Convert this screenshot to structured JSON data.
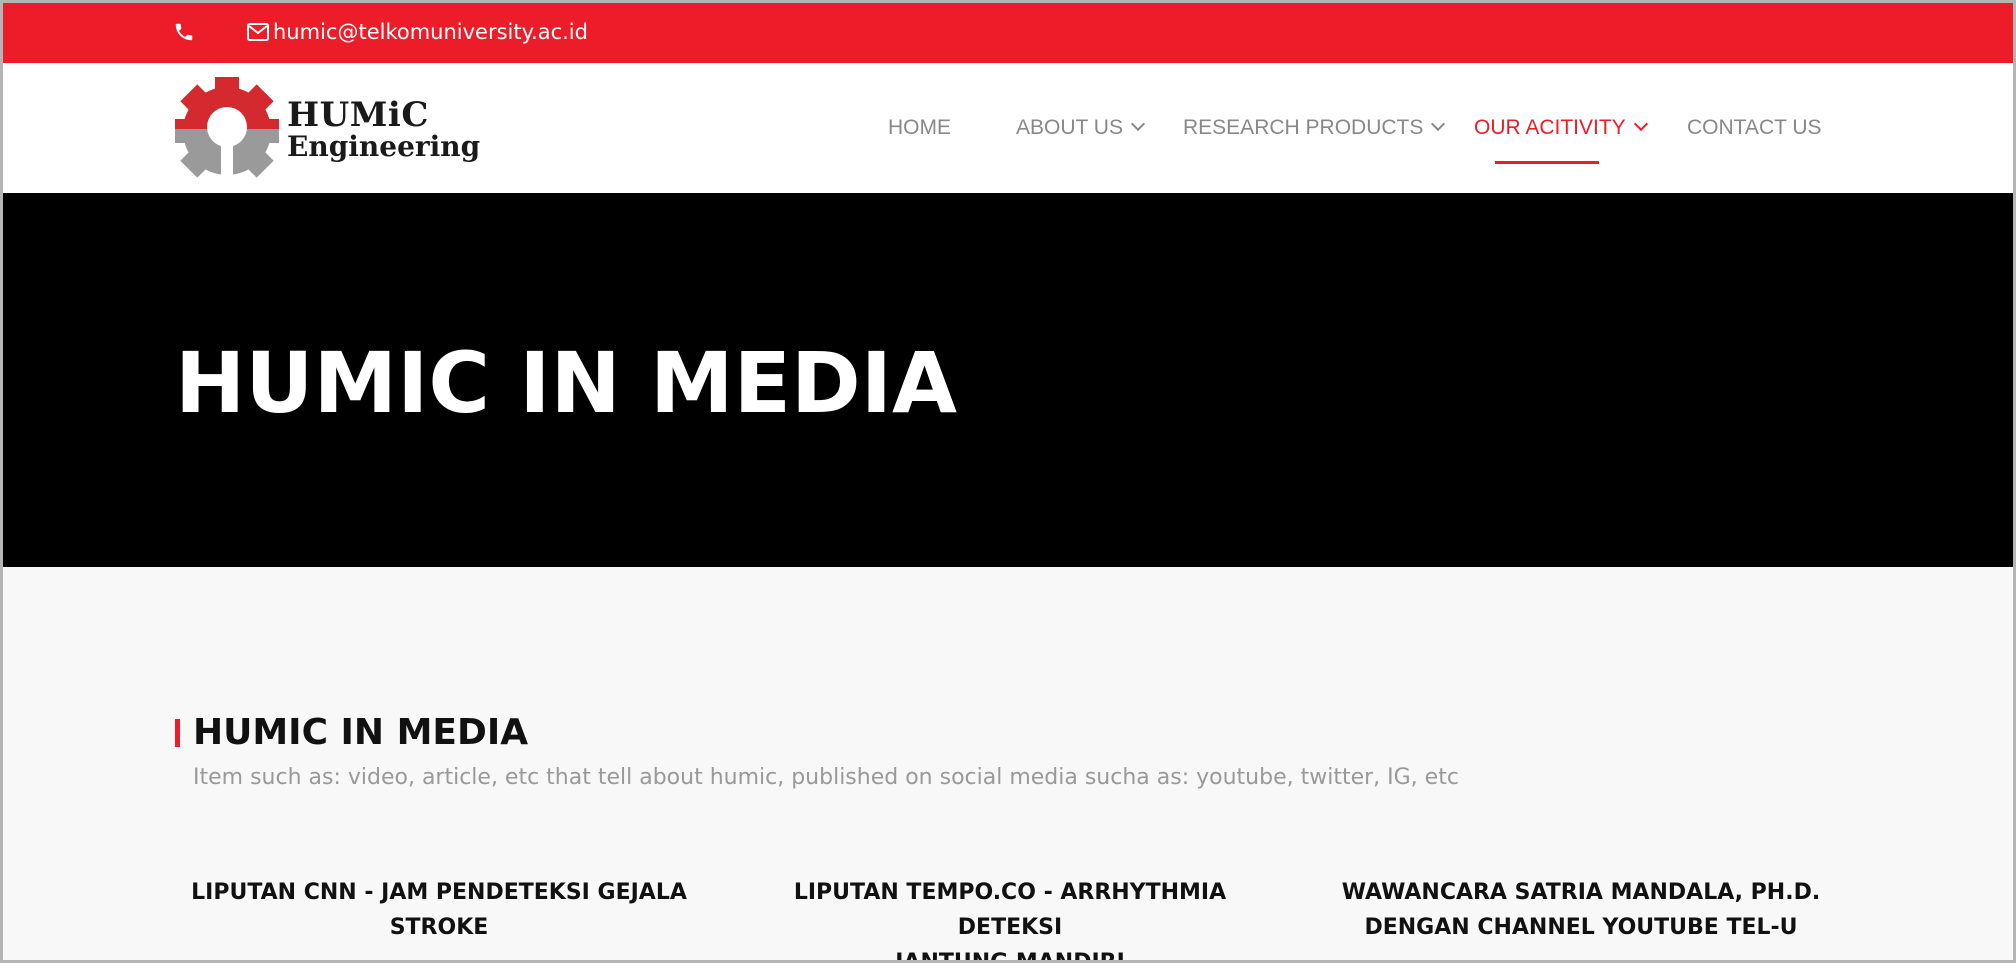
{
  "topbar": {
    "phone_icon": "phone-icon",
    "mail_icon": "envelope-icon",
    "email": "humic@telkomuniversity.ac.id",
    "color": "#ec1c28"
  },
  "header": {
    "logo": {
      "line1": "HUMiC",
      "line2": "Engineering",
      "icon": "gear-icon"
    },
    "nav": [
      {
        "label": "HOME",
        "dropdown": false,
        "active": false
      },
      {
        "label": "ABOUT US",
        "dropdown": true,
        "active": false
      },
      {
        "label": "RESEARCH PRODUCTS",
        "dropdown": true,
        "active": false
      },
      {
        "label": "OUR ACITIVITY",
        "dropdown": true,
        "active": true
      },
      {
        "label": "CONTACT US",
        "dropdown": false,
        "active": false
      }
    ],
    "active_color": "#ec1c28"
  },
  "hero": {
    "title": "HUMIC IN MEDIA"
  },
  "section": {
    "title": "HUMIC IN MEDIA",
    "subtitle": "Item such as: video, article, etc that tell about humic, published on social media sucha as: youtube, twitter, IG, etc"
  },
  "cards": [
    {
      "title_line1": "LIPUTAN CNN - JAM PENDETEKSI GEJALA",
      "title_line2": "STROKE"
    },
    {
      "title_line1": "LIPUTAN TEMPO.CO - ARRHYTHMIA DETEKSI",
      "title_line2": "JANTUNG MANDIRI"
    },
    {
      "title_line1": "WAWANCARA SATRIA MANDALA, PH.D.",
      "title_line2": "DENGAN CHANNEL YOUTUBE TEL-U"
    }
  ]
}
